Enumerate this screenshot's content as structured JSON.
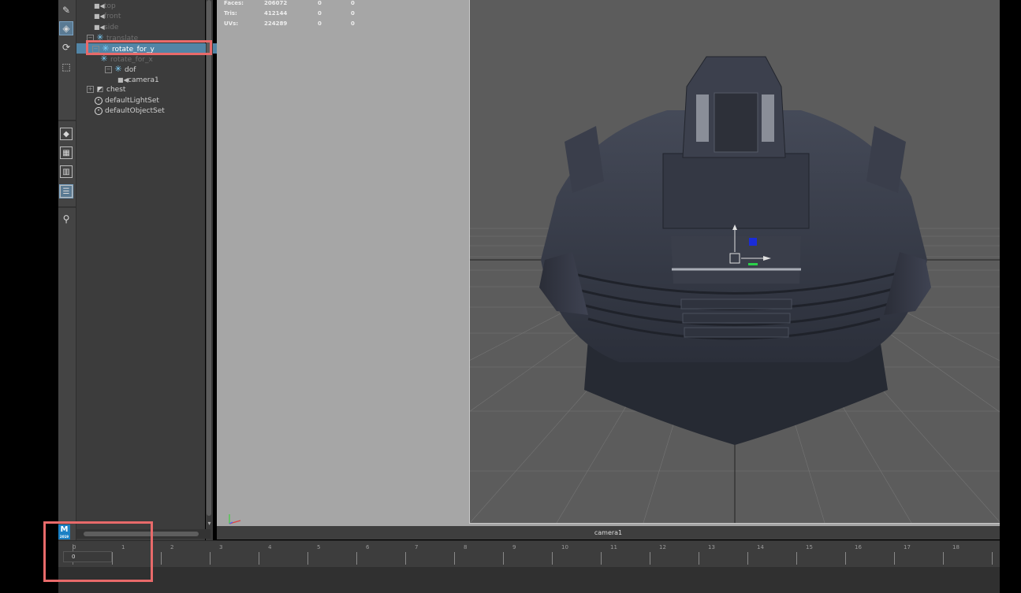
{
  "outliner": {
    "items": [
      {
        "label": "top",
        "icon": "camera-icon",
        "dim": true
      },
      {
        "label": "front",
        "icon": "camera-icon",
        "dim": true
      },
      {
        "label": "side",
        "icon": "camera-icon",
        "dim": true
      },
      {
        "label": "translate",
        "icon": "transform-star-icon",
        "dim": true
      },
      {
        "label": "rotate_for_y",
        "icon": "transform-star-icon",
        "selected": true
      },
      {
        "label": "rotate_for_x",
        "icon": "transform-star-icon",
        "dim": true
      },
      {
        "label": "dof",
        "icon": "transform-star-icon"
      },
      {
        "label": "camera1",
        "icon": "camera-icon"
      },
      {
        "label": "chest",
        "icon": "mesh-icon"
      },
      {
        "label": "defaultLightSet",
        "icon": "set-icon"
      },
      {
        "label": "defaultObjectSet",
        "icon": "set-icon"
      }
    ]
  },
  "hud": {
    "rows": [
      {
        "label": "Faces:",
        "values": [
          "206072",
          "0",
          "0"
        ]
      },
      {
        "label": "Tris:",
        "values": [
          "412144",
          "0",
          "0"
        ]
      },
      {
        "label": "UVs:",
        "values": [
          "224289",
          "0",
          "0"
        ]
      }
    ]
  },
  "viewport": {
    "camera_label": "camera1"
  },
  "timeline": {
    "current_frame": "0",
    "frames": [
      "0",
      "1",
      "2",
      "3",
      "4",
      "5",
      "6",
      "7",
      "8",
      "9",
      "10",
      "11",
      "12",
      "13",
      "14",
      "15",
      "16",
      "17",
      "18"
    ]
  },
  "logo": {
    "letter": "M",
    "sub": "2019"
  },
  "colors": {
    "selection": "#5285a6",
    "highlight_annotation": "#e86a6a",
    "transform_icon": "#7fd3ff"
  }
}
